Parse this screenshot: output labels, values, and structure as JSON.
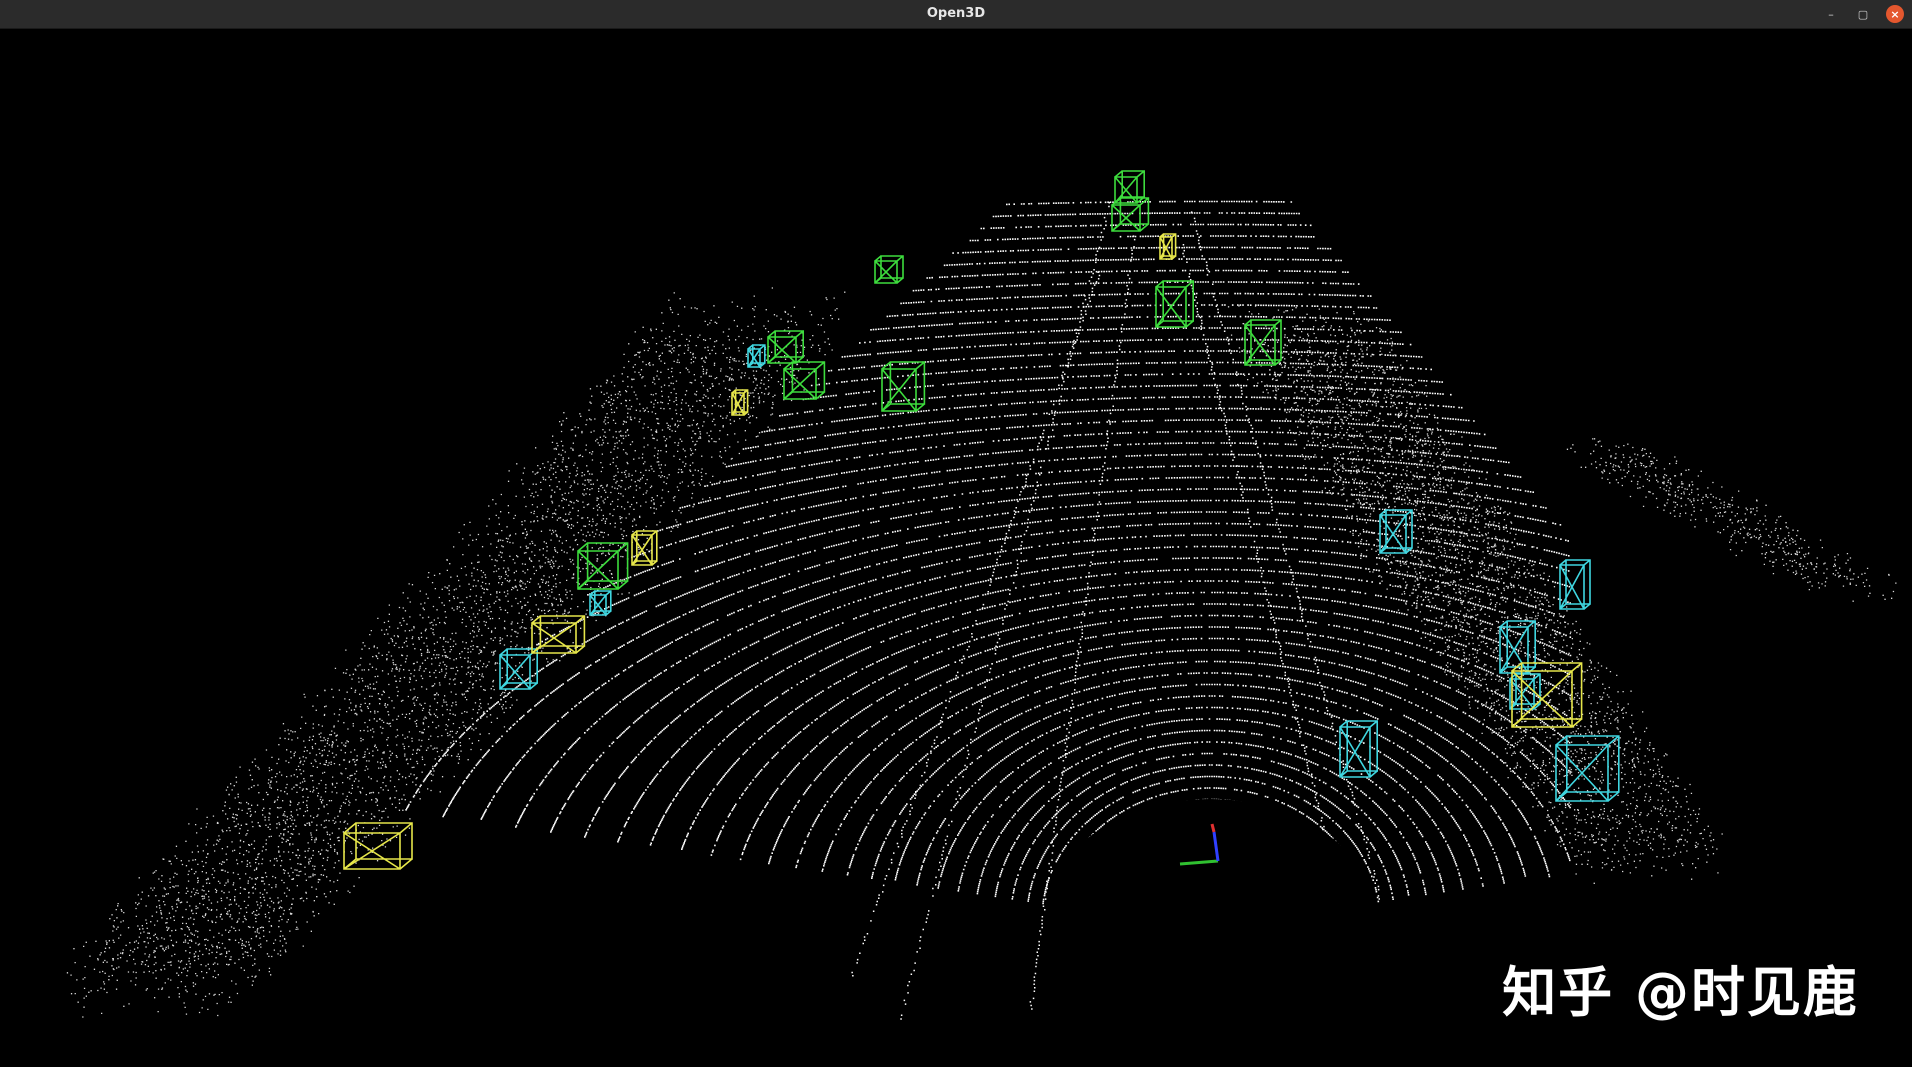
{
  "window": {
    "title": "Open3D",
    "buttons": {
      "minimize": "–",
      "maximize": "▢",
      "close": "×"
    }
  },
  "colors": {
    "background": "#000000",
    "points": "#ffffff",
    "box_car": "#3ddc3d",
    "box_pedestrian": "#3fd6e0",
    "box_cyclist": "#e6e64a",
    "axis_x": "#e03030",
    "axis_y": "#30c030",
    "axis_z": "#3040ff"
  },
  "watermark": {
    "text": "知乎 @时见鹿"
  }
}
